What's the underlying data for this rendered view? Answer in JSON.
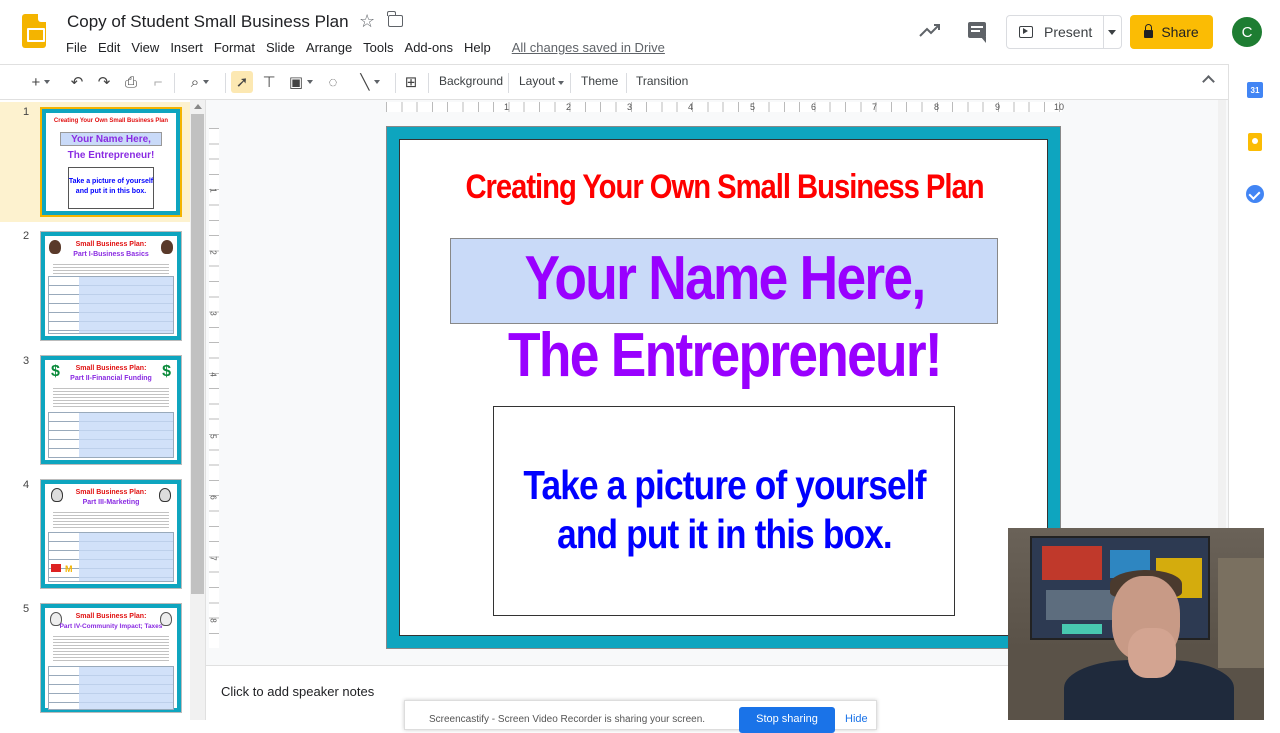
{
  "app": {
    "document_title": "Copy of Student Small Business Plan",
    "menu": [
      "File",
      "Edit",
      "View",
      "Insert",
      "Format",
      "Slide",
      "Arrange",
      "Tools",
      "Add-ons",
      "Help"
    ],
    "save_status": "All changes saved in Drive",
    "present_label": "Present",
    "share_label": "Share",
    "avatar_letter": "C"
  },
  "toolbar": {
    "background_label": "Background",
    "layout_label": "Layout",
    "theme_label": "Theme",
    "transition_label": "Transition"
  },
  "ruler": {
    "horizontal": [
      "1",
      "2",
      "3",
      "4",
      "5",
      "6",
      "7",
      "8",
      "9",
      "10"
    ],
    "vertical": [
      "1",
      "2",
      "3",
      "4",
      "5",
      "6",
      "7",
      "8"
    ]
  },
  "filmstrip": {
    "slides": [
      {
        "number": "1",
        "title": "Creating Your Own Small Business Plan",
        "subtitle_1": "Your Name Here,",
        "subtitle_2": "The Entrepreneur!",
        "body_1": "Take a picture of yourself",
        "body_2": "and put it in this box."
      },
      {
        "number": "2",
        "title": "Small Business Plan:",
        "subtitle": "Part I-Business Basics"
      },
      {
        "number": "3",
        "title": "Small Business Plan:",
        "subtitle": "Part II-Financial Funding"
      },
      {
        "number": "4",
        "title": "Small Business Plan:",
        "subtitle": "Part III-Marketing"
      },
      {
        "number": "5",
        "title": "Small Business Plan:",
        "subtitle": "Part IV-Community Impact; Taxes"
      }
    ]
  },
  "slide": {
    "title": "Creating Your Own Small Business Plan",
    "name_line_1": "Your Name Here,",
    "name_line_2": "The Entrepreneur!",
    "photo_line_1": "Take a picture of yourself",
    "photo_line_2": "and put it in this box.",
    "colors": {
      "frame": "#0ea5bf",
      "title": "#ff0000",
      "name": "#9900ff",
      "photo_text": "#0000ff",
      "name_box": "#c9daf8"
    }
  },
  "notes": {
    "placeholder": "Click to add speaker notes"
  },
  "screen_share": {
    "message": "Screencastify - Screen Video Recorder is sharing your screen.",
    "stop_label": "Stop sharing",
    "hide_label": "Hide"
  },
  "side_panel": {
    "calendar_day": "31"
  },
  "colors": {
    "accent": "#fbbc04",
    "avatar": "#1e7d32",
    "link": "#1a73e8"
  }
}
